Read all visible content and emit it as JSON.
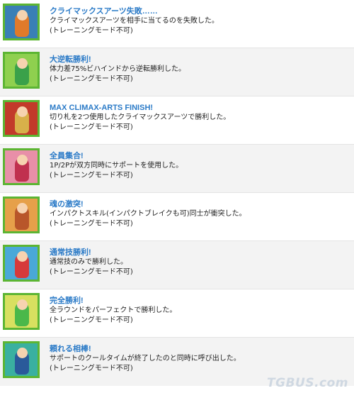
{
  "items": [
    {
      "title": "クライマックスアーツ失敗……",
      "description": "クライマックスアーツを相手に当てるのを失敗した。",
      "note": "(トレーニングモード不可)",
      "icon": "character-portrait-icon",
      "colors": {
        "bg": "#3a7fb6",
        "fig": "#e07a2a"
      }
    },
    {
      "title": "大逆転勝利!",
      "description": "体力差75%ビハインドから逆転勝利した。",
      "note": "(トレーニングモード不可)",
      "icon": "character-portrait-icon",
      "colors": {
        "bg": "#8fd04f",
        "fig": "#3aa14a"
      }
    },
    {
      "title": "MAX CLIMAX-ARTS FINISH!",
      "description": "切り札を2つ使用したクライマックスアーツで勝利した。",
      "note": "(トレーニングモード不可)",
      "icon": "character-portrait-icon",
      "colors": {
        "bg": "#c23a2a",
        "fig": "#d8b04a"
      }
    },
    {
      "title": "全員集合!",
      "description": "1P/2Pが双方同時にサポートを使用した。",
      "note": "(トレーニングモード不可)",
      "icon": "character-portrait-icon",
      "colors": {
        "bg": "#e88fa8",
        "fig": "#c0304f"
      }
    },
    {
      "title": "魂の激突!",
      "description": "インパクトスキル(インパクトブレイクも可)同士が衝突した。",
      "note": "(トレーニングモード不可)",
      "icon": "character-portrait-icon",
      "colors": {
        "bg": "#e6a04a",
        "fig": "#b8562a"
      }
    },
    {
      "title": "通常技勝利!",
      "description": "通常技のみで勝利した。",
      "note": "(トレーニングモード不可)",
      "icon": "character-portrait-icon",
      "colors": {
        "bg": "#4aa8d8",
        "fig": "#d63a3a"
      }
    },
    {
      "title": "完全勝利!",
      "description": "全ラウンドをパーフェクトで勝利した。",
      "note": "(トレーニングモード不可)",
      "icon": "character-portrait-icon",
      "colors": {
        "bg": "#d8e060",
        "fig": "#4ab84a"
      }
    },
    {
      "title": "頼れる相棒!",
      "description": "サポートのクールタイムが終了したのと同時に呼び出した。",
      "note": "(トレーニングモード不可)",
      "icon": "character-portrait-icon",
      "colors": {
        "bg": "#3ab0a0",
        "fig": "#2a5a9a"
      }
    }
  ],
  "watermark": "TGBUS.com"
}
